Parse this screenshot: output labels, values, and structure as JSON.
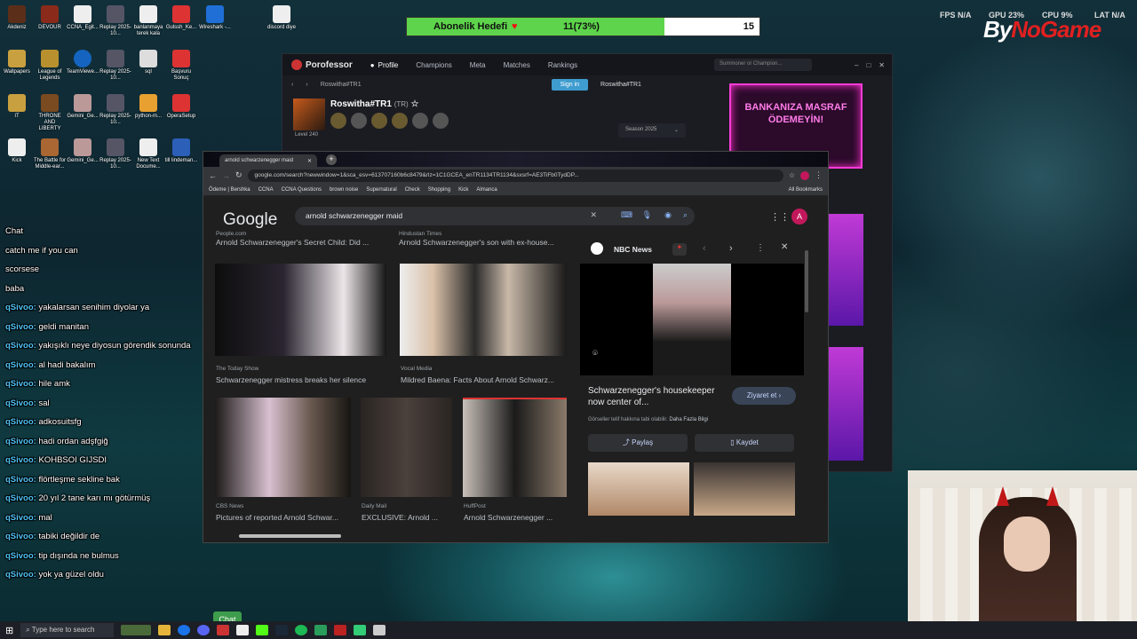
{
  "stream_goal": {
    "label": "Abonelik Hedefi",
    "progress_text": "11(73%)",
    "progress_fraction": 0.73,
    "target": "15"
  },
  "hud": {
    "fps_label": "FPS",
    "fps": "N/A",
    "gpu_label": "GPU",
    "gpu": "23%",
    "cpu_label": "CPU",
    "cpu": "9%",
    "lat_label": "LAT",
    "lat": "N/A"
  },
  "brand": {
    "prefix": "By",
    "name": "NoGame"
  },
  "desktop_icons": [
    "Akdeniz",
    "DEVOUR",
    "CCNA_Egit...",
    "Replay 2025-10...",
    "banlanmaya terek kala",
    "Gulssh_Ke...",
    "Wireshark -...",
    "discord diye",
    "Wallpapers",
    "League of Legends",
    "TeamViewe...",
    "Replay 2025-10...",
    "sql",
    "Başvuru Sonuç",
    "IT",
    "THRONE AND LIBERTY",
    "Gemini_Ge...",
    "Replay 2025-10...",
    "python-m...",
    "OperaSetup",
    "Kick",
    "The Battle for Middle-ear...",
    "Gemini_Ge...",
    "Replay 2025-10...",
    "New Text Docume...",
    "till lindeman..."
  ],
  "chat": [
    {
      "user": "",
      "text": "Chat"
    },
    {
      "user": "",
      "text": "catch me if you can"
    },
    {
      "user": "",
      "text": "scorsese"
    },
    {
      "user": "",
      "text": "baba"
    },
    {
      "user": "qSivoo:",
      "text": "yakalarsan senihim diyolar ya"
    },
    {
      "user": "qSivoo:",
      "text": "geldi manitan"
    },
    {
      "user": "qSivoo:",
      "text": "yakışıklı neye diyosun görendik sonunda"
    },
    {
      "user": "qSivoo:",
      "text": "al hadi bakalım"
    },
    {
      "user": "qSivoo:",
      "text": "hile amk"
    },
    {
      "user": "qSivoo:",
      "text": "sal"
    },
    {
      "user": "qSivoo:",
      "text": "adkosuitsfg"
    },
    {
      "user": "qSivoo:",
      "text": "hadi ordan adşfgiğ"
    },
    {
      "user": "qSivoo:",
      "text": "KOHBSOI GIJSDI"
    },
    {
      "user": "qSivoo:",
      "text": "flörtleşme sekline bak"
    },
    {
      "user": "qSivoo:",
      "text": "20 yıl 2 tane karı mı götürmüş"
    },
    {
      "user": "qSivoo:",
      "text": "mal"
    },
    {
      "user": "qSivoo:",
      "text": "tabiki değildir de"
    },
    {
      "user": "qSivoo:",
      "text": "tip dışında ne bulmus"
    },
    {
      "user": "qSivoo:",
      "text": "yok ya güzel oldu"
    }
  ],
  "porofessor": {
    "app_name": "Porofessor",
    "nav": [
      "Profile",
      "Champions",
      "Meta",
      "Matches",
      "Rankings"
    ],
    "search_placeholder": "Summoner or Champion...",
    "breadcrumb": "Roswitha#TR1",
    "sign_in": "Sign in",
    "user": "Roswitha#TR1",
    "summoner": "Roswitha#TR1",
    "region": "(TR)",
    "level": "Level 240",
    "season": "Season 2025"
  },
  "ad": {
    "text": "BANKANIZA MASRAF ÖDEMEYİN!"
  },
  "browser": {
    "tab_title": "arnold schwarzenegger maid",
    "url": "google.com/search?newwindow=1&sca_esv=613707160b6c8479&rlz=1C1GCEA_enTR1134TR1134&sxsrf=AE3TiFb0TydDP...",
    "bookmarks": [
      "Ödeme | Bershka",
      "CCNA",
      "CCNA Questions",
      "brown noise",
      "Supernatural",
      "Check",
      "Shopping",
      "Kick",
      "Almanca",
      "All Bookmarks"
    ]
  },
  "google": {
    "logo": "Google",
    "query": "arnold schwarzenegger maid",
    "results": [
      {
        "source": "People.com",
        "title": "Arnold Schwarzenegger's Secret Child: Did ..."
      },
      {
        "source": "Hindustan Times",
        "title": "Arnold Schwarzenegger's son with ex-house..."
      },
      {
        "source": "The Today Show",
        "title": "Schwarzenegger mistress breaks her silence"
      },
      {
        "source": "Vocal Media",
        "title": "Mildred Baena: Facts About Arnold Schwarz..."
      },
      {
        "source": "CBS News",
        "title": "Pictures of reported Arnold Schwar..."
      },
      {
        "source": "Daily Mail",
        "title": "EXCLUSIVE: Arnold ..."
      },
      {
        "source": "HuffPost",
        "title": "Arnold Schwarzenegger ..."
      }
    ],
    "panel": {
      "source": "NBC News",
      "title": "Schwarzenegger's housekeeper now center of...",
      "visit": "Ziyaret et",
      "rights": "Görseller telif hakkına tabi olabilir.",
      "more": "Daha Fazla Bilgi",
      "share": "Paylaş",
      "save": "Kaydet"
    }
  },
  "taskbar": {
    "search_placeholder": "Type here to search",
    "chat_button": "Chat"
  }
}
